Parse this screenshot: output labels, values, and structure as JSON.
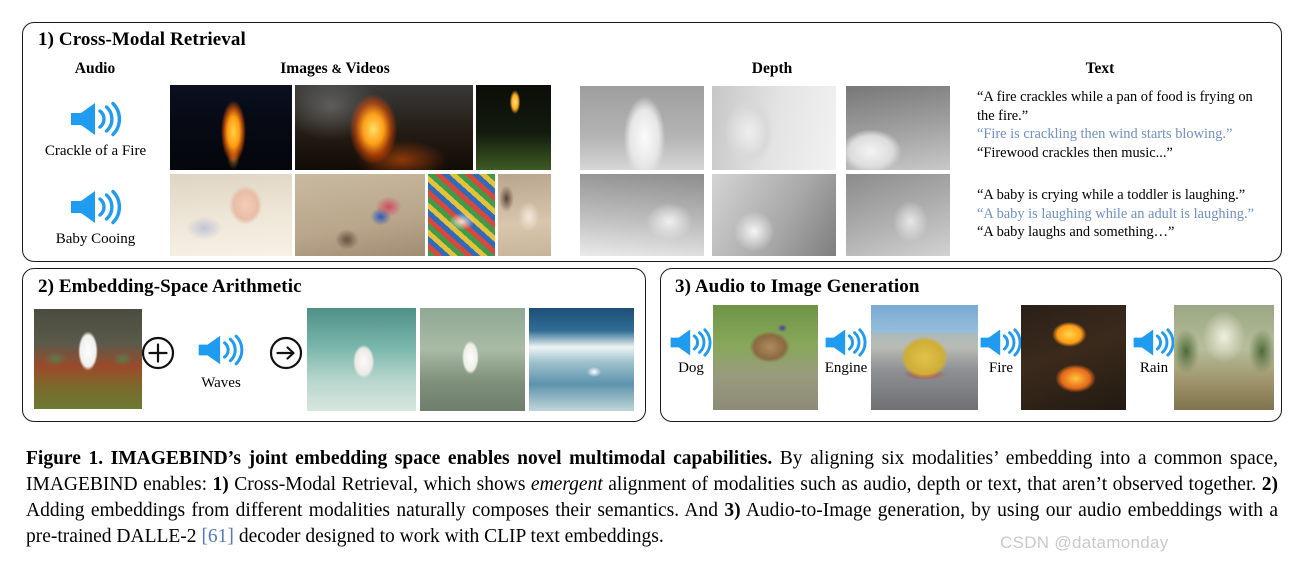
{
  "figure": {
    "watermark": "CSDN @datamonday",
    "accent_blue": "#1f9cf0",
    "text_highlight_blue": "#6f8fc6",
    "citation_blue": "#5577c0"
  },
  "panel1": {
    "title": "1) Cross-Modal Retrieval",
    "columns": {
      "audio": "Audio",
      "images": "Images",
      "amp": "&",
      "videos": "Videos",
      "depth": "Depth",
      "text": "Text"
    },
    "rows": [
      {
        "audio_label": "Crackle of a Fire",
        "audio_icon": "speaker-icon",
        "texts": [
          {
            "value": "“A fire crackles while a pan of food is frying on",
            "style": "normal"
          },
          {
            "value": "the fire.”",
            "style": "normal"
          },
          {
            "value": "“Fire is crackling then wind starts blowing.”",
            "style": "highlight"
          },
          {
            "value": "“Firewood crackles then music...”",
            "style": "normal"
          }
        ]
      },
      {
        "audio_label": "Baby Cooing",
        "audio_icon": "speaker-icon",
        "texts": [
          {
            "value": "“A baby is crying while a toddler is laughing.”",
            "style": "normal"
          },
          {
            "value": "“A baby is laughing while an adult is laughing.”",
            "style": "highlight"
          },
          {
            "value": "“A baby laughs and something…”",
            "style": "normal"
          }
        ]
      }
    ]
  },
  "panel2": {
    "title": "2) Embedding-Space Arithmetic",
    "source_image_alt": "great egret standing in red and green coastal vegetation",
    "plus_icon": "circled-plus-icon",
    "audio_icon": "speaker-icon",
    "audio_label": "Waves",
    "arrow_icon": "circled-right-arrow-icon",
    "results": [
      "white heron wading in shallow turquoise sea water",
      "snowy egret standing on wet rocky shoreline",
      "egret feeding at the edge of breaking ocean waves"
    ]
  },
  "panel3": {
    "title": "3) Audio to Image Generation",
    "items": [
      {
        "label": "Dog",
        "audio_icon": "speaker-icon",
        "image_alt": "german shepherd dog standing on grass"
      },
      {
        "label": "Engine",
        "audio_icon": "speaker-icon",
        "image_alt": "yellow and red bus driving on a road"
      },
      {
        "label": "Fire",
        "audio_icon": "speaker-icon",
        "image_alt": "close up campfire flames over charred logs"
      },
      {
        "label": "Rain",
        "audio_icon": "speaker-icon",
        "image_alt": "heavy rain falling over green trees"
      }
    ]
  },
  "caption": {
    "figure_number": "Figure 1.",
    "bold_title_a": "IMAGEBIND",
    "bold_title_b": "’s joint embedding space enables novel multimodal capabilities.",
    "body_1": " By aligning six modalities’ embedding into a common space, ",
    "sc_2": "IMAGEBIND",
    "body_2": " enables: ",
    "num_1": "1)",
    "body_3": " Cross-Modal Retrieval, which shows ",
    "italic_1": "emergent",
    "body_4": " alignment of modalities such as audio, depth or text, that aren’t observed together. ",
    "num_2": "2)",
    "body_5": " Adding embeddings from different modalities naturally composes their semantics. And ",
    "num_3": "3)",
    "body_6": " Audio-to-Image generation, by using our audio embeddings with a pre-trained DALLE-2 ",
    "citation": "[61]",
    "body_7": " decoder designed to work with CLIP text embeddings."
  }
}
